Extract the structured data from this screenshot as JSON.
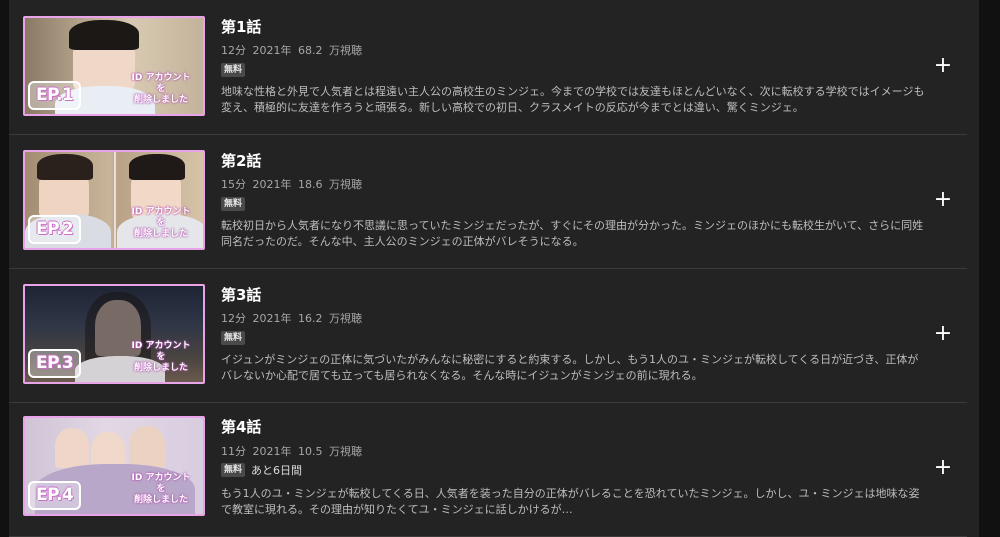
{
  "episodes": [
    {
      "title": "第1話",
      "duration": "12分",
      "year": "2021年",
      "views": "68.2 万視聴",
      "free_badge": "無料",
      "remaining": "",
      "ep_label": "EP.1",
      "description": "地味な性格と外見で人気者とは程遠い主人公の高校生のミンジェ。今までの学校では友達もほとんどいなく、次に転校する学校ではイメージも変え、積極的に友達を作ろうと頑張る。新しい高校での初日、クラスメイトの反応が今までとは違い、驚くミンジェ。",
      "add_icon": "plus-icon"
    },
    {
      "title": "第2話",
      "duration": "15分",
      "year": "2021年",
      "views": "18.6 万視聴",
      "free_badge": "無料",
      "remaining": "",
      "ep_label": "EP.2",
      "description": "転校初日から人気者になり不思議に思っていたミンジェだったが、すぐにその理由が分かった。ミンジェのほかにも転校生がいて、さらに同姓同名だったのだ。そんな中、主人公のミンジェの正体がバレそうになる。",
      "add_icon": "plus-icon"
    },
    {
      "title": "第3話",
      "duration": "12分",
      "year": "2021年",
      "views": "16.2 万視聴",
      "free_badge": "無料",
      "remaining": "",
      "ep_label": "EP.3",
      "description": "イジュンがミンジェの正体に気づいたがみんなに秘密にすると約束する。しかし、もう1人のユ・ミンジェが転校してくる日が近づき、正体がバレないか心配で居ても立っても居られなくなる。そんな時にイジュンがミンジェの前に現れる。",
      "add_icon": "plus-icon"
    },
    {
      "title": "第4話",
      "duration": "11分",
      "year": "2021年",
      "views": "10.5 万視聴",
      "free_badge": "無料",
      "remaining": "あと6日間",
      "ep_label": "EP.4",
      "description": "もう1人のユ・ミンジェが転校してくる日、人気者を装った自分の正体がバレることを恐れていたミンジェ。しかし、ユ・ミンジェは地味な姿で教室に現れる。その理由が知りたくてユ・ミンジェに話しかけるが…",
      "add_icon": "plus-icon"
    }
  ],
  "colors": {
    "background": "#111111",
    "panel": "#232323",
    "thumb_border": "#e9a3e8",
    "meta_text": "#a7a7a7",
    "desc_text": "#bdbdbd"
  }
}
